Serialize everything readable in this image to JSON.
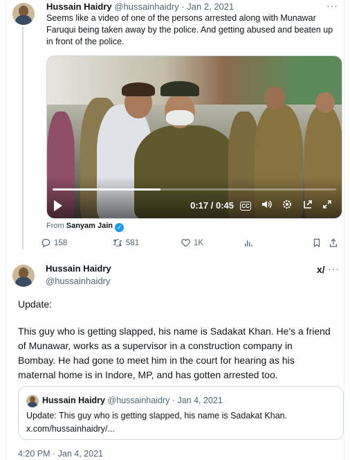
{
  "first_tweet": {
    "name": "Hussain Haidry",
    "handle": "@hussainhaidry",
    "separator": "·",
    "date": "Jan 2, 2021",
    "more": "···",
    "text": "Seems like a video of one of the persons arrested along with Munawar Faruqui being taken away by the police. And getting abused and beaten up in front of the police.",
    "video": {
      "time": "0:17 / 0:45",
      "progress": 0.38,
      "cc_label": "CC",
      "icons": [
        "play-icon",
        "captions-icon",
        "volume-icon",
        "settings-icon",
        "pip-icon",
        "fullscreen-icon"
      ]
    },
    "from_label": "From",
    "from_name": "Sanyam Jain",
    "actions": {
      "replies": "158",
      "reposts": "581",
      "likes": "1K"
    }
  },
  "main_tweet": {
    "name": "Hussain Haidry",
    "handle": "@hussainhaidry",
    "grok": "x/",
    "more": "···",
    "paragraph1": "Update:",
    "paragraph2_lines": [
      "This guy who is getting slapped, his name is Sadakat Khan. He's a friend",
      "of Munawar, works as a supervisor in a construction company in",
      "Bombay. He had gone to meet him in the court for hearing as his",
      "maternal home is in Indore, MP, and has gotten arrested too."
    ],
    "quote": {
      "name": "Hussain Haidry",
      "handle": "@hussainhaidry",
      "separator": "·",
      "date": "Jan 4, 2021",
      "line1": "Update: This guy who is getting slapped, his name is Sadakat Khan.",
      "line2": "x.com/hussainhaidry/..."
    },
    "timestamp": "4:20 PM · Jan 4, 2021"
  },
  "colors": {
    "text": "#0f1419",
    "muted": "#536471",
    "border": "#cfd9de",
    "verified": "#1d9bf0"
  }
}
